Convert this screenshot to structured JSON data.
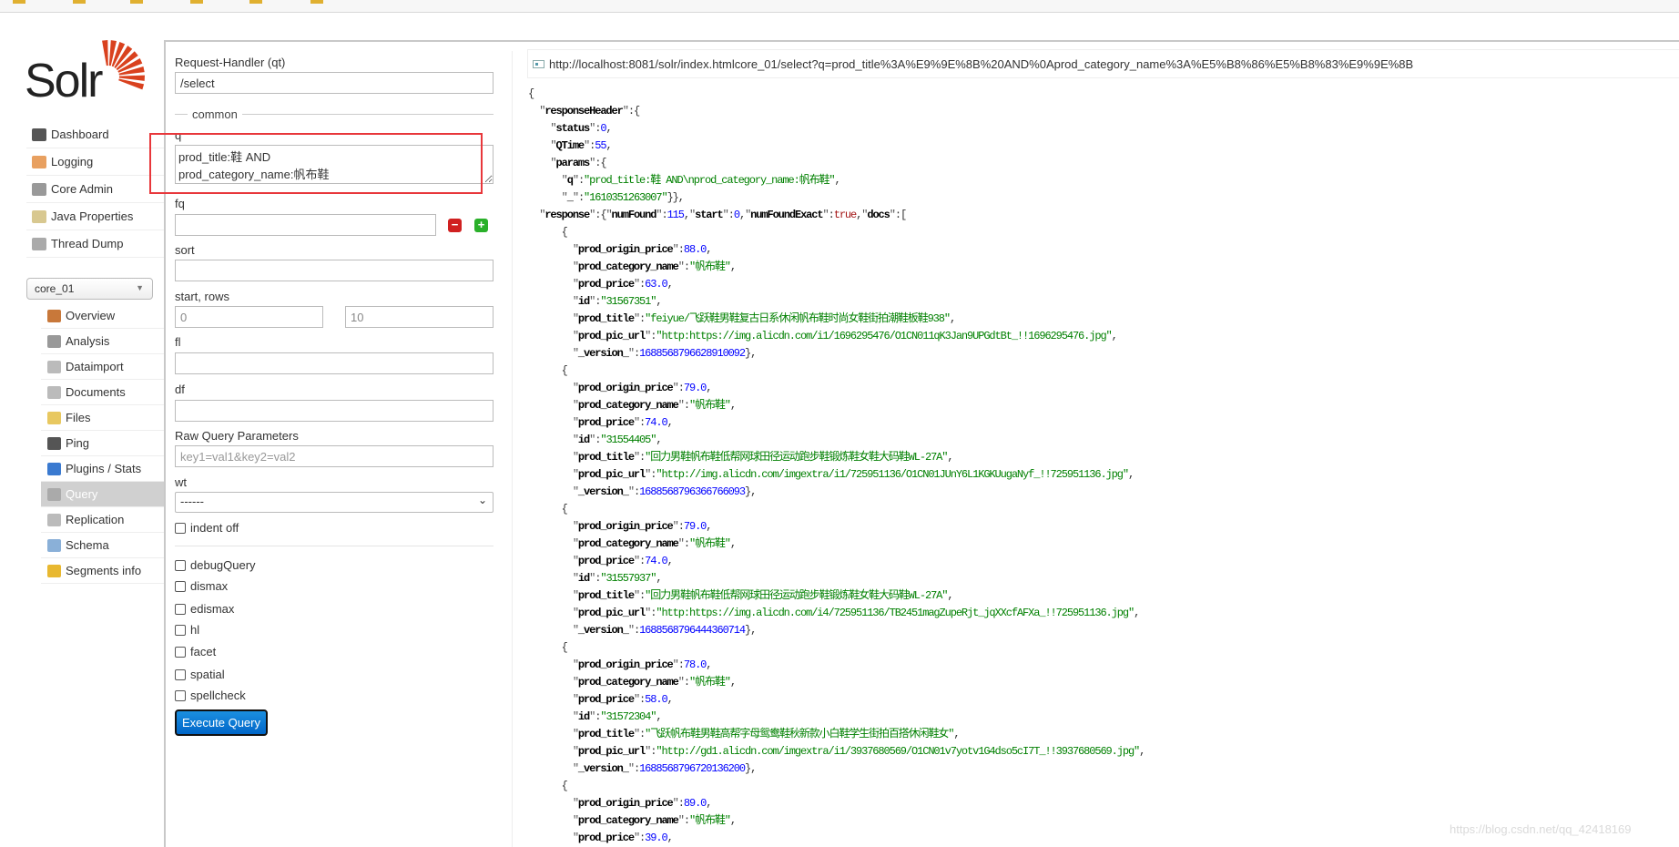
{
  "logo": {
    "text": "Solr",
    "accent": "#d9411e"
  },
  "sidebar": {
    "items": [
      {
        "label": "Dashboard",
        "icon": "dashboard-icon",
        "color": "#555"
      },
      {
        "label": "Logging",
        "icon": "logging-icon",
        "color": "#e8a060"
      },
      {
        "label": "Core Admin",
        "icon": "core-admin-icon",
        "color": "#999"
      },
      {
        "label": "Java Properties",
        "icon": "java-properties-icon",
        "color": "#d8c890"
      },
      {
        "label": "Thread Dump",
        "icon": "thread-dump-icon",
        "color": "#aaa"
      }
    ],
    "core_selector": {
      "value": "core_01"
    },
    "core_items": [
      {
        "label": "Overview",
        "icon": "overview-icon",
        "color": "#c8783a"
      },
      {
        "label": "Analysis",
        "icon": "analysis-icon",
        "color": "#999"
      },
      {
        "label": "Dataimport",
        "icon": "dataimport-icon",
        "color": "#bbb"
      },
      {
        "label": "Documents",
        "icon": "documents-icon",
        "color": "#bbb"
      },
      {
        "label": "Files",
        "icon": "files-icon",
        "color": "#e8c860"
      },
      {
        "label": "Ping",
        "icon": "ping-icon",
        "color": "#555"
      },
      {
        "label": "Plugins / Stats",
        "icon": "plugins-icon",
        "color": "#3a7ad0"
      },
      {
        "label": "Query",
        "icon": "query-icon",
        "color": "#aaa",
        "active": true
      },
      {
        "label": "Replication",
        "icon": "replication-icon",
        "color": "#bbb"
      },
      {
        "label": "Schema",
        "icon": "schema-icon",
        "color": "#8ab0d8"
      },
      {
        "label": "Segments info",
        "icon": "segments-icon",
        "color": "#e8b830"
      }
    ]
  },
  "form": {
    "request_handler_label": "Request-Handler (qt)",
    "request_handler_value": "/select",
    "common_legend": "common",
    "q_label": "q",
    "q_value": "prod_title:鞋 AND\nprod_category_name:帆布鞋",
    "fq_label": "fq",
    "fq_value": "",
    "sort_label": "sort",
    "start_rows_label": "start, rows",
    "start_value": "0",
    "rows_value": "10",
    "fl_label": "fl",
    "df_label": "df",
    "raw_label": "Raw Query Parameters",
    "raw_placeholder": "key1=val1&key2=val2",
    "wt_label": "wt",
    "wt_value": "------",
    "indent_label": "indent off",
    "options": [
      "debugQuery",
      "dismax",
      "edismax",
      "hl",
      "facet",
      "spatial",
      "spellcheck"
    ],
    "execute_label": "Execute Query",
    "accent": "#0a7ad6",
    "highlight_color": "#e8373b"
  },
  "result": {
    "url": "http://localhost:8081/solr/index.htmlcore_01/select?q=prod_title%3A%E9%9E%8B%20AND%0Aprod_category_name%3A%E5%B8%86%E5%B8%83%E9%9E%8B",
    "status": "0",
    "qtime": "55",
    "params_q": "prod_title:鞋 AND\\nprod_category_name:帆布鞋",
    "params_underscore": "1610351263007",
    "numFound": "115",
    "start": "0",
    "numFoundExact": "true",
    "docs": [
      {
        "prod_origin_price": "88.0",
        "prod_category_name": "帆布鞋",
        "prod_price": "63.0",
        "id": "31567351",
        "prod_title": "feiyue/飞跃鞋男鞋复古日系休闲帆布鞋时尚女鞋街拍潮鞋板鞋938",
        "prod_pic_url": "http:https://img.alicdn.com/i1/1696295476/O1CN011qK3Jan9UPGdtBt_!!1696295476.jpg",
        "_version_": "1688568796628910092"
      },
      {
        "prod_origin_price": "79.0",
        "prod_category_name": "帆布鞋",
        "prod_price": "74.0",
        "id": "31554405",
        "prod_title": "回力男鞋帆布鞋低帮网球田径运动跑步鞋锻炼鞋女鞋大码鞋WL-27A",
        "prod_pic_url": "http://img.alicdn.com/imgextra/i1/725951136/O1CN01JUnY6L1KGKUugaNyf_!!725951136.jpg",
        "_version_": "1688568796366766093"
      },
      {
        "prod_origin_price": "79.0",
        "prod_category_name": "帆布鞋",
        "prod_price": "74.0",
        "id": "31557937",
        "prod_title": "回力男鞋帆布鞋低帮网球田径运动跑步鞋锻炼鞋女鞋大码鞋WL-27A",
        "prod_pic_url": "http:https://img.alicdn.com/i4/725951136/TB2451magZupeRjt_jqXXcfAFXa_!!725951136.jpg",
        "_version_": "1688568796444360714"
      },
      {
        "prod_origin_price": "78.0",
        "prod_category_name": "帆布鞋",
        "prod_price": "58.0",
        "id": "31572304",
        "prod_title": "飞跃帆布鞋男鞋高帮字母鸳鸯鞋秋新款小白鞋学生街拍百搭休闲鞋女",
        "prod_pic_url": "http://gd1.alicdn.com/imgextra/i1/3937680569/O1CN01v7yotv1G4dso5cI7T_!!3937680569.jpg",
        "_version_": "1688568796720136200"
      },
      {
        "prod_origin_price": "89.0",
        "prod_category_name": "帆布鞋",
        "prod_price": "39.0"
      }
    ]
  },
  "watermark": "https://blog.csdn.net/qq_42418169"
}
